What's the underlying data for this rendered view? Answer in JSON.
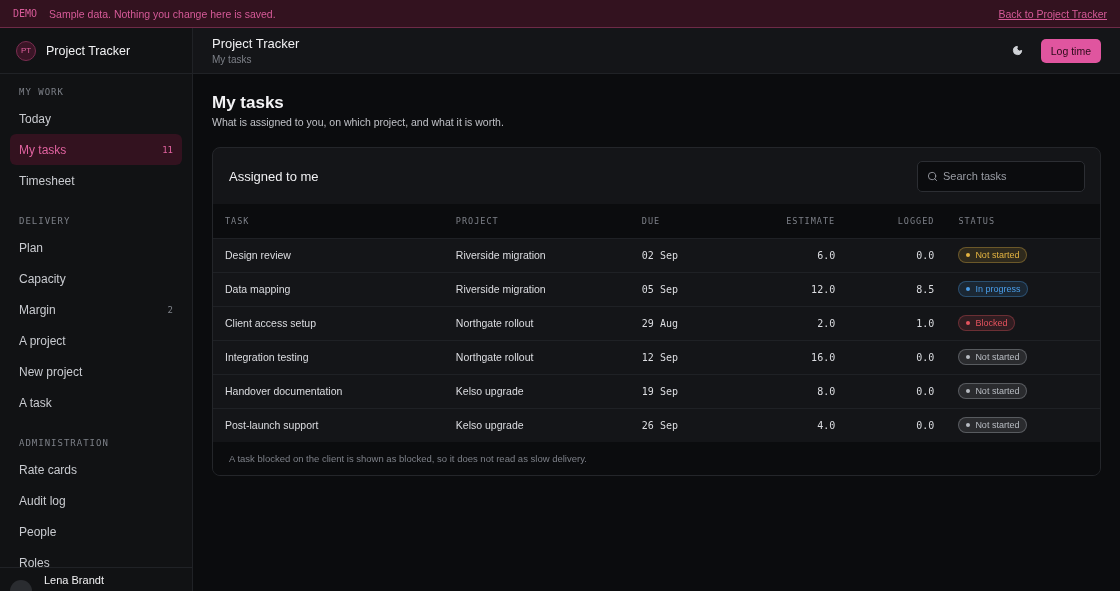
{
  "banner": {
    "tag": "DEMO",
    "message": "Sample data. Nothing you change here is saved.",
    "link": "Back to Project Tracker"
  },
  "brand": {
    "initials": "PT",
    "name": "Project Tracker"
  },
  "sidebar": {
    "sections": [
      {
        "title": "MY WORK",
        "items": [
          {
            "label": "Today",
            "selected": false
          },
          {
            "label": "My tasks",
            "selected": true,
            "count": "11"
          },
          {
            "label": "Timesheet",
            "selected": false
          }
        ]
      },
      {
        "title": "DELIVERY",
        "items": [
          {
            "label": "Plan",
            "selected": false
          },
          {
            "label": "Capacity",
            "selected": false
          },
          {
            "label": "Margin",
            "selected": false,
            "count": "2"
          },
          {
            "label": "A project",
            "selected": false
          },
          {
            "label": "New project",
            "selected": false
          },
          {
            "label": "A task",
            "selected": false
          }
        ]
      },
      {
        "title": "ADMINISTRATION",
        "items": [
          {
            "label": "Rate cards",
            "selected": false
          },
          {
            "label": "Audit log",
            "selected": false
          },
          {
            "label": "People",
            "selected": false
          },
          {
            "label": "Roles",
            "selected": false
          }
        ]
      }
    ],
    "user": {
      "name": "Lena Brandt"
    }
  },
  "header": {
    "title": "Project Tracker",
    "breadcrumb": "My tasks",
    "button": "Log time"
  },
  "page": {
    "title": "My tasks",
    "subtitle": "What is assigned to you, on which project, and what it is worth."
  },
  "card": {
    "title": "Assigned to me",
    "search": {
      "placeholder": "Search tasks"
    },
    "table": {
      "columns": [
        "TASK",
        "PROJECT",
        "DUE",
        "ESTIMATE",
        "LOGGED",
        "STATUS"
      ],
      "rows": [
        {
          "task": "Design review",
          "project": "Riverside migration",
          "due": "02 Sep",
          "estimate": "6.0",
          "logged": "0.0",
          "status": {
            "label": "Not started",
            "color": "#e3b341"
          }
        },
        {
          "task": "Data mapping",
          "project": "Riverside migration",
          "due": "05 Sep",
          "estimate": "12.0",
          "logged": "8.5",
          "status": {
            "label": "In progress",
            "color": "#4a9eea"
          }
        },
        {
          "task": "Client access setup",
          "project": "Northgate rollout",
          "due": "29 Aug",
          "estimate": "2.0",
          "logged": "1.0",
          "status": {
            "label": "Blocked",
            "color": "#e5535e"
          }
        },
        {
          "task": "Integration testing",
          "project": "Northgate rollout",
          "due": "12 Sep",
          "estimate": "16.0",
          "logged": "0.0",
          "status": {
            "label": "Not started",
            "color": "#b8bcc2"
          }
        },
        {
          "task": "Handover documentation",
          "project": "Kelso upgrade",
          "due": "19 Sep",
          "estimate": "8.0",
          "logged": "0.0",
          "status": {
            "label": "Not started",
            "color": "#b8bcc2"
          }
        },
        {
          "task": "Post-launch support",
          "project": "Kelso upgrade",
          "due": "26 Sep",
          "estimate": "4.0",
          "logged": "0.0",
          "status": {
            "label": "Not started",
            "color": "#b8bcc2"
          }
        }
      ]
    },
    "footnote": "A task blocked on the client is shown as blocked, so it does not read as slow delivery."
  }
}
